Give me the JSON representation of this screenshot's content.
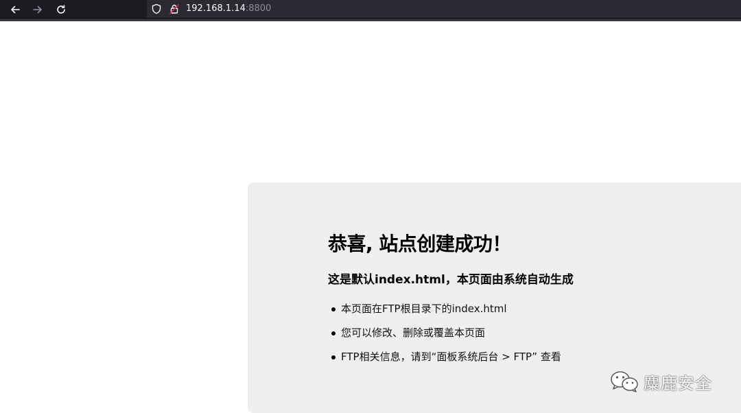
{
  "browser": {
    "url_host": "192.168.1.14",
    "url_port": ":8800",
    "icons": [
      "back-arrow-icon",
      "forward-arrow-icon",
      "reload-icon",
      "shield-icon",
      "insecure-lock-icon"
    ]
  },
  "page": {
    "heading": "恭喜, 站点创建成功！",
    "subheading": "这是默认index.html，本页面由系统自动生成",
    "items": [
      "本页面在FTP根目录下的index.html",
      "您可以修改、删除或覆盖本页面",
      "FTP相关信息，请到“面板系统后台 > FTP” 查看"
    ]
  },
  "watermark": {
    "text": "麋鹿安全",
    "icon": "wechat-icon"
  },
  "colors": {
    "toolbar_bg": "#1c1b22",
    "urlbar_bg": "#2b2a33",
    "card_bg": "#efefef",
    "insecure_red": "#e22850"
  }
}
